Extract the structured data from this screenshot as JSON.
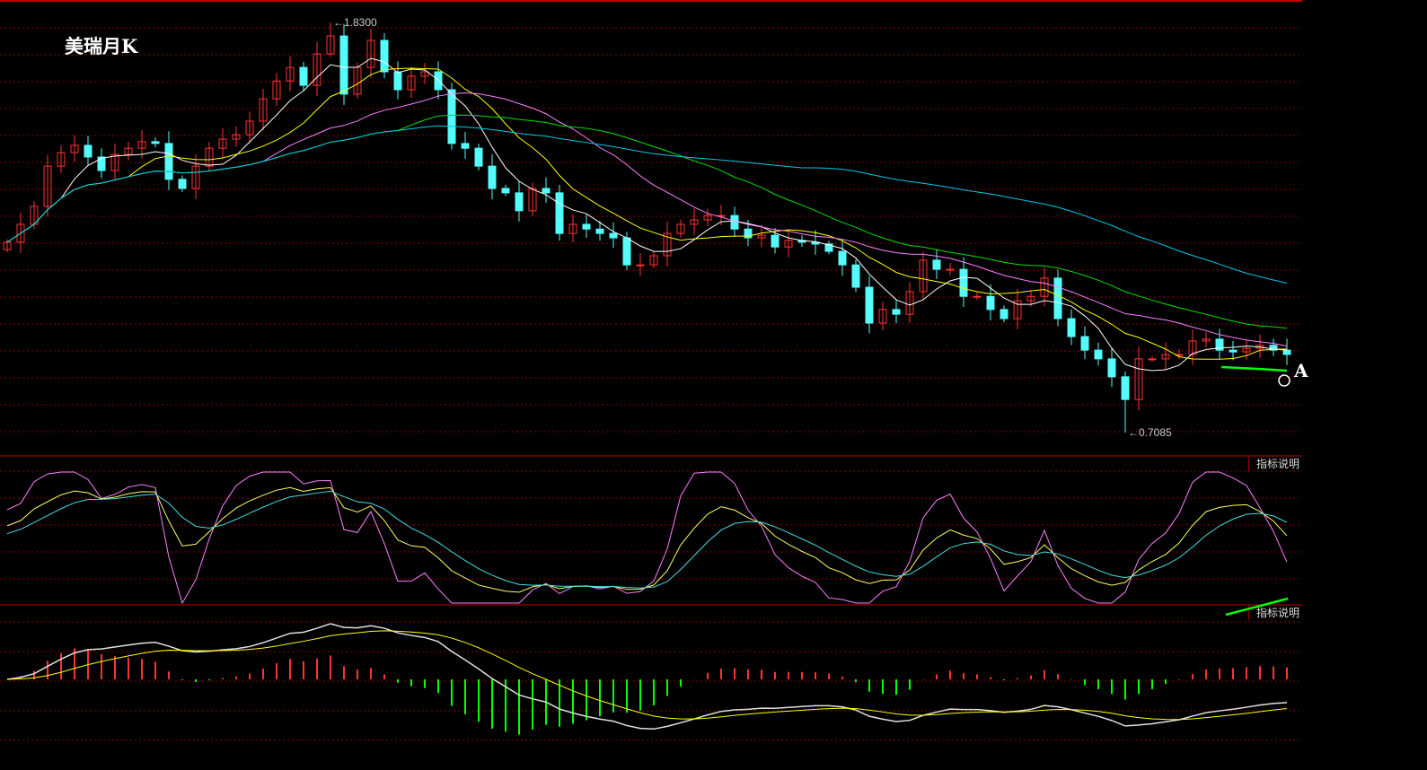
{
  "title": "美瑞月K",
  "indicator_label_1": "指标说明",
  "indicator_label_2": "指标说明",
  "annotation_letter": "A",
  "colors": {
    "up": "#ff3232",
    "down": "#54fcfc",
    "grid": "#8b0000",
    "ma5": "#ffffff",
    "ma10": "#ffff00",
    "ma20": "#ff80ff",
    "ma30": "#00e000",
    "ma60": "#00c8e8",
    "k": "#ffff60",
    "d": "#40e0e0",
    "j": "#ff80ff",
    "dif": "#e0e0e0",
    "dea": "#ffff00",
    "macd_up": "#ff3232",
    "macd_down": "#00ff00",
    "trend": "#00ff00"
  },
  "chart_data": {
    "type": "candlestick",
    "title": "美瑞月K",
    "period": "monthly",
    "max_label": "1.8300",
    "min_label": "0.7085",
    "extremes": {
      "high": 1.83,
      "low": 0.7085,
      "high_index": 24,
      "low_index": 83
    },
    "ylim": [
      0.7,
      1.84
    ],
    "closes": [
      1.229,
      1.278,
      1.327,
      1.437,
      1.474,
      1.494,
      1.462,
      1.425,
      1.469,
      1.486,
      1.504,
      1.499,
      1.401,
      1.376,
      1.437,
      1.486,
      1.511,
      1.523,
      1.56,
      1.621,
      1.67,
      1.707,
      1.658,
      1.744,
      1.793,
      1.634,
      1.707,
      1.781,
      1.695,
      1.646,
      1.683,
      1.695,
      1.646,
      1.499,
      1.486,
      1.437,
      1.376,
      1.364,
      1.315,
      1.376,
      1.364,
      1.253,
      1.278,
      1.265,
      1.253,
      1.241,
      1.167,
      1.167,
      1.192,
      1.253,
      1.278,
      1.29,
      1.302,
      1.302,
      1.265,
      1.241,
      1.248,
      1.216,
      1.234,
      1.229,
      1.224,
      1.204,
      1.167,
      1.106,
      1.008,
      1.045,
      1.032,
      1.094,
      1.18,
      1.155,
      1.155,
      1.081,
      1.081,
      1.045,
      1.02,
      1.069,
      1.081,
      1.131,
      1.02,
      0.971,
      0.934,
      0.91,
      0.861,
      0.799,
      0.91,
      0.91,
      0.922,
      0.922,
      0.959,
      0.964,
      0.934,
      0.929,
      0.939,
      0.947,
      0.934,
      0.922
    ],
    "moving_averages": [
      5,
      10,
      20,
      30,
      60
    ],
    "indicators": [
      "KDJ",
      "MACD"
    ]
  }
}
